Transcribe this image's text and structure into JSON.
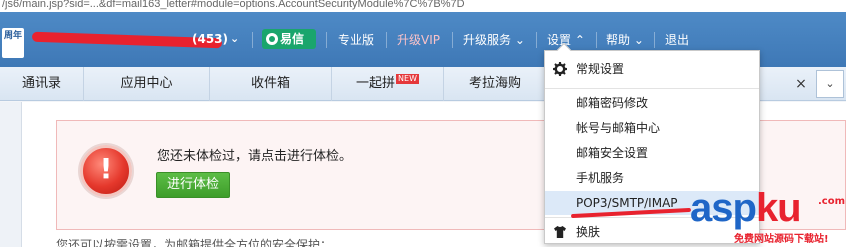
{
  "browser": {
    "url": "/js6/main.jsp?sid=...&df=mail163_letter#module=options.AccountSecurityModule%7C%7B%7D"
  },
  "header": {
    "logo_text": "周年",
    "account_suffix": "(453)",
    "yixin_label": "易信",
    "nav": {
      "pro": "专业版",
      "vip": "升级VIP",
      "upgrade_service": "升级服务",
      "settings": "设置",
      "help": "帮助",
      "logout": "退出"
    },
    "chevron": "⌄",
    "settings_chevron": "⌃"
  },
  "tabs": [
    {
      "label": "通讯录"
    },
    {
      "label": "应用中心"
    },
    {
      "label": "收件箱"
    },
    {
      "label": "一起拼",
      "badge": "NEW"
    },
    {
      "label": "考拉海购"
    }
  ],
  "tab_close": "×",
  "tab_more": "⌄",
  "alert": {
    "message": "您还未体检过，请点击进行体检。",
    "button": "进行体检",
    "icon": "!"
  },
  "bottom_text": "您还可以按需设置，为邮箱提供全方位的安全保护：",
  "settings_menu": {
    "items": [
      {
        "label": "常规设置",
        "icon": "gear-icon"
      },
      {
        "label": "邮箱密码修改"
      },
      {
        "label": "帐号与邮箱中心"
      },
      {
        "label": "邮箱安全设置"
      },
      {
        "label": "手机服务"
      },
      {
        "label": "POP3/SMTP/IMAP",
        "highlighted": true
      },
      {
        "label": "换肤",
        "icon": "shirt-icon"
      }
    ]
  },
  "watermark": {
    "main_a": "asp",
    "main_b": "ku",
    "com": ".com",
    "sub": "免费网站源码下载站!"
  },
  "colors": {
    "header_blue": "#4e8ac6",
    "green_button": "#3e9d2a",
    "yixin_green": "#1aa56c",
    "alert_red": "#e5382c",
    "annotation_red": "#e8222e",
    "menu_highlight": "#dce9f8"
  }
}
